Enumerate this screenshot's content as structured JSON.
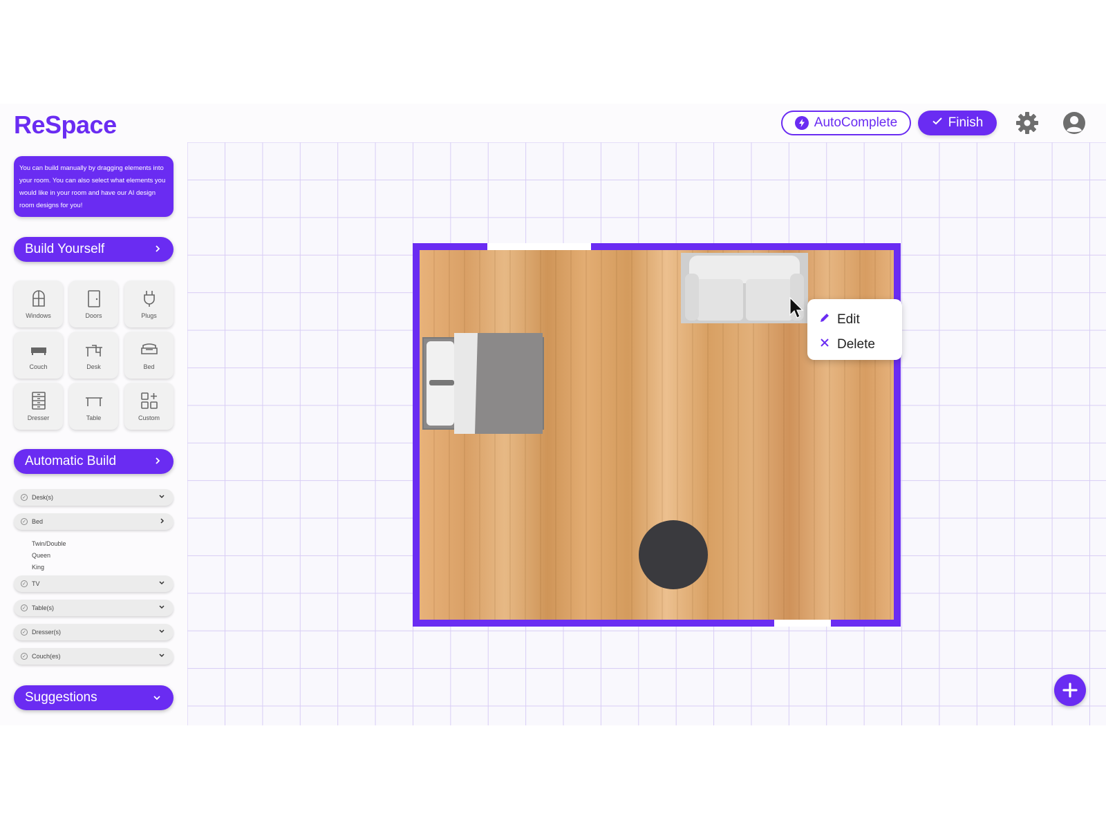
{
  "app": {
    "title": "ReSpace"
  },
  "header": {
    "autocomplete_label": "AutoComplete",
    "finish_label": "Finish",
    "settings_icon": "gear-icon",
    "profile_icon": "user-icon"
  },
  "sidebar": {
    "info_text": "You can build manually by dragging elements into your room. You can also select what elements you would like in your room and have our AI design room designs for you!",
    "build_yourself_label": "Build Yourself",
    "elements": [
      {
        "label": "Windows",
        "icon": "window-icon"
      },
      {
        "label": "Doors",
        "icon": "door-icon"
      },
      {
        "label": "Plugs",
        "icon": "plug-icon"
      },
      {
        "label": "Couch",
        "icon": "couch-icon"
      },
      {
        "label": "Desk",
        "icon": "desk-icon"
      },
      {
        "label": "Bed",
        "icon": "bed-icon"
      },
      {
        "label": "Dresser",
        "icon": "dresser-icon"
      },
      {
        "label": "Table",
        "icon": "table-icon"
      },
      {
        "label": "Custom",
        "icon": "custom-icon"
      }
    ],
    "automatic_build_label": "Automatic Build",
    "options": [
      {
        "label": "Desk(s)",
        "state": "collapsed"
      },
      {
        "label": "Bed",
        "state": "expanded",
        "sub_options": [
          "Twin/Double",
          "Queen",
          "King"
        ]
      },
      {
        "label": "TV",
        "state": "collapsed"
      },
      {
        "label": "Table(s)",
        "state": "collapsed"
      },
      {
        "label": "Dresser(s)",
        "state": "collapsed"
      },
      {
        "label": "Couch(es)",
        "state": "collapsed"
      }
    ],
    "suggestions_label": "Suggestions"
  },
  "context_menu": {
    "edit_label": "Edit",
    "delete_label": "Delete"
  },
  "colors": {
    "accent": "#6a2cf2",
    "grid": "#d8cdf5",
    "rug": "#3a3a3e"
  }
}
